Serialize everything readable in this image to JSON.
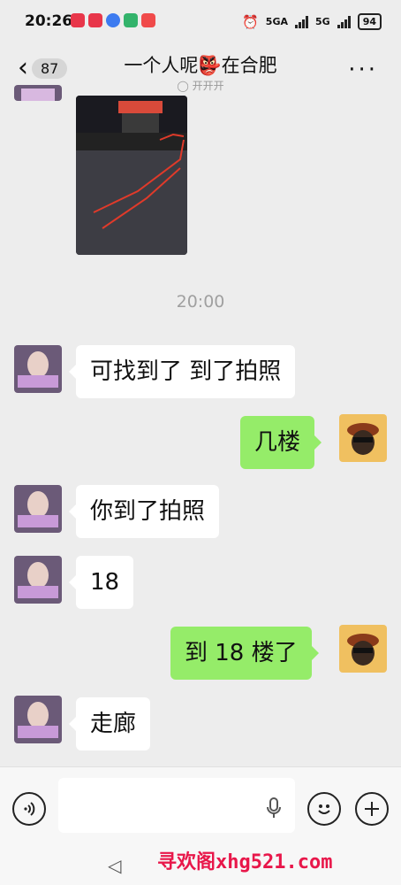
{
  "status_bar": {
    "time": "20:26",
    "signal_1": "5GA",
    "signal_2": "5G",
    "battery": "94"
  },
  "header": {
    "back_count": "87",
    "title": "一个人呢👺在合肥",
    "subtitle": "◯ 开开开"
  },
  "messages": [
    {
      "side": "left",
      "text": "可找到了 到了拍照"
    },
    {
      "side": "right",
      "text": "几楼"
    },
    {
      "side": "left",
      "text": "你到了拍照"
    },
    {
      "side": "left",
      "text": "18"
    },
    {
      "side": "right",
      "text": "到 18 楼了"
    },
    {
      "side": "left",
      "text": "走廊"
    }
  ],
  "timestamp": "20:00",
  "input": {
    "value": "",
    "placeholder": ""
  },
  "watermark": "寻欢阁xhg521.com",
  "colors": {
    "background": "#ededed",
    "bubble_out": "#95ec69",
    "bubble_in": "#ffffff"
  },
  "icons": [
    "back-arrow-icon",
    "more-icon",
    "voice-icon",
    "microphone-icon",
    "emoji-icon",
    "plus-icon",
    "nav-back-icon"
  ]
}
